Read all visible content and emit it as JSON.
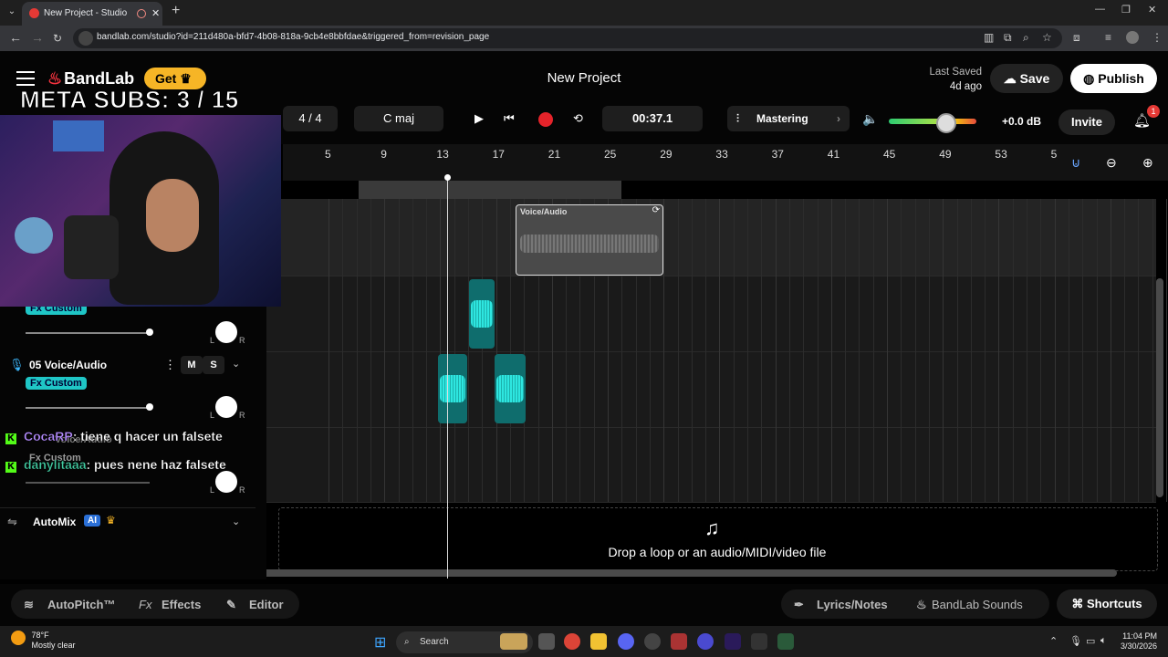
{
  "browser": {
    "tab_title": "New Project - Studio",
    "url": "bandlab.com/studio?id=211d480a-bfd7-4b08-818a-9cb4e8bbfdae&triggered_from=revision_page"
  },
  "header": {
    "logo": "BandLab",
    "get_label": "Get",
    "project_title": "New Project",
    "last_saved_label": "Last Saved",
    "last_saved_value": "4d ago",
    "save_label": "Save",
    "publish_label": "Publish"
  },
  "transport": {
    "time_signature": "4 / 4",
    "key": "C maj",
    "time": "00:37.1",
    "mastering_label": "Mastering",
    "master_level": 0.66,
    "db_value": "+0.0 dB",
    "invite_label": "Invite",
    "notification_count": "1"
  },
  "ruler": {
    "bars": [
      "5",
      "9",
      "13",
      "17",
      "21",
      "25",
      "29",
      "33",
      "37",
      "41",
      "45",
      "49",
      "53",
      "5"
    ]
  },
  "tracks": {
    "region_name": "Voice/Audio",
    "fx_label": "Fx Custom",
    "track5_name": "05  Voice/Audio",
    "mute": "M",
    "solo": "S",
    "pan_l": "L",
    "pan_r": "R"
  },
  "dropzone": {
    "text": "Drop a loop or an audio/MIDI/video file"
  },
  "automix": {
    "label": "AutoMix",
    "ai": "AI"
  },
  "bottom": {
    "autopitch": "AutoPitch™",
    "effects_prefix": "Fx",
    "effects": "Effects",
    "editor": "Editor",
    "lyrics": "Lyrics/Notes",
    "sounds": "BandLab Sounds",
    "shortcuts": "Shortcuts"
  },
  "overlay": {
    "meta_subs": "META SUBS: 3 / 15",
    "chat": [
      {
        "user": "CocaRP",
        "msg": ": tiene q hacer un falsete",
        "color": "#b48cff"
      },
      {
        "user": "danylitaaa",
        "msg": ": pues nene haz falsete",
        "color": "#41c9a0"
      }
    ],
    "ghost_track": "Voice/Audio",
    "ghost_fx": "Fx Custom"
  },
  "taskbar": {
    "temp": "78°F",
    "weather": "Mostly clear",
    "search": "Search",
    "time": "11:04 PM",
    "date": "3/30/2026"
  }
}
